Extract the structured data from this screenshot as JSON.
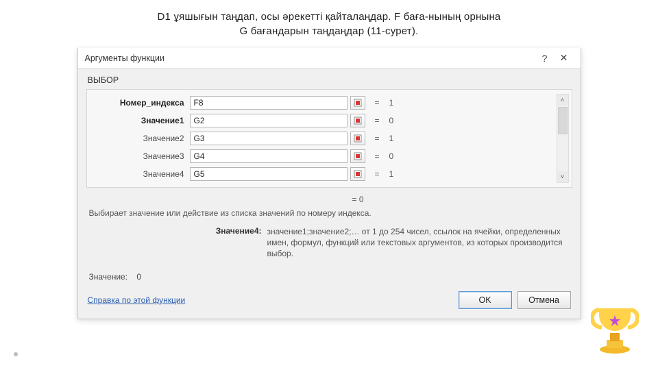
{
  "caption": {
    "line1": "D1 ұяшығын таңдап, осы әрекетті қайталаңдар. F баға-нының орнына",
    "line2": "G бағандарын таңдаңдар (11-сурет)."
  },
  "dialog": {
    "title": "Аргументы функции",
    "help_btn": "?",
    "close_btn": "✕",
    "function_name": "ВЫБОР",
    "args": [
      {
        "label": "Номер_индекса",
        "bold": true,
        "value": "F8",
        "result": "1"
      },
      {
        "label": "Значение1",
        "bold": true,
        "value": "G2",
        "result": "0"
      },
      {
        "label": "Значение2",
        "bold": false,
        "value": "G3",
        "result": "1"
      },
      {
        "label": "Значение3",
        "bold": false,
        "value": "G4",
        "result": "0"
      },
      {
        "label": "Значение4",
        "bold": false,
        "value": "G5",
        "result": "1"
      }
    ],
    "eq": "=",
    "final_eq": "=  0",
    "description": "Выбирает значение или действие из списка значений по номеру индекса.",
    "help_label": "Значение4:",
    "help_text": "значение1;значение2;… от 1 до 254 чисел, ссылок на ячейки, определенных имен, формул, функций или текстовых аргументов, из которых производится выбор.",
    "result_label": "Значение:",
    "result_value": "0",
    "help_link": "Справка по этой функции",
    "ok": "OK",
    "cancel": "Отмена"
  },
  "icons": {
    "scroll_up": "˄",
    "scroll_down": "˅"
  }
}
